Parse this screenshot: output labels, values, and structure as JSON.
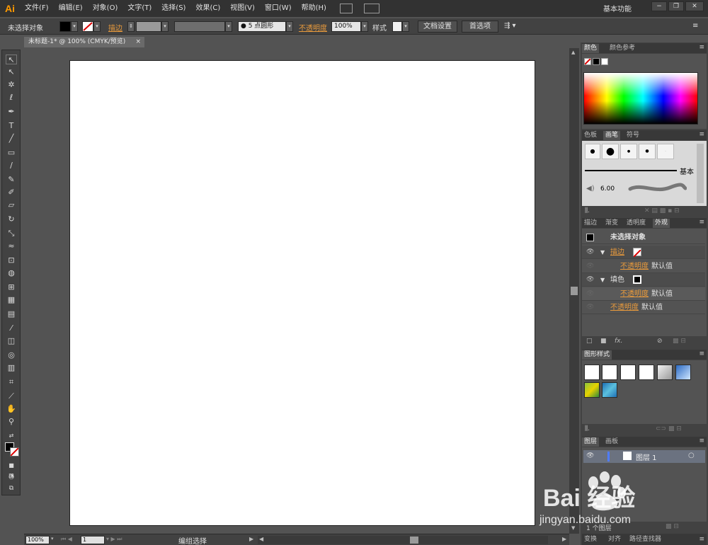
{
  "menubar": {
    "logo": "Ai",
    "items": [
      "文件(F)",
      "编辑(E)",
      "对象(O)",
      "文字(T)",
      "选择(S)",
      "效果(C)",
      "视图(V)",
      "窗口(W)",
      "帮助(H)"
    ],
    "workspace": "基本功能",
    "window_buttons": [
      "−",
      "❐",
      "✕"
    ]
  },
  "control": {
    "selection_label": "未选择对象",
    "stroke_label": "描边",
    "brush_value": "5 点圆形",
    "opacity_label": "不透明度",
    "opacity_value": "100%",
    "style_label": "样式",
    "doc_setup_button": "文档设置",
    "prefs_button": "首选项"
  },
  "document": {
    "tab_title": "未标题-1* @ 100% (CMYK/预览)",
    "tab_close": "×"
  },
  "status": {
    "zoom": "100%",
    "page": "1",
    "mode": "编组选择"
  },
  "panels": {
    "color": {
      "tabs": [
        "颜色",
        "颜色参考"
      ]
    },
    "brush": {
      "tabs": [
        "色板",
        "画笔",
        "符号"
      ],
      "basic_label": "基本",
      "size_value": "6.00"
    },
    "appearance": {
      "tabs": [
        "描边",
        "渐变",
        "透明度",
        "外观"
      ],
      "title": "未选择对象",
      "stroke_label": "描边",
      "opacity_label": "不透明度",
      "default_value": "默认值",
      "fill_label": "填色",
      "fx_label": "fx."
    },
    "graphic_styles": {
      "tabs": [
        "图形样式"
      ]
    },
    "layers": {
      "tabs": [
        "图层",
        "画板"
      ],
      "layer_name": "图层 1",
      "footer": "1 个图层"
    },
    "bottom": {
      "tabs": [
        "变换",
        "对齐",
        "路径查找器"
      ]
    }
  },
  "watermark": {
    "brand": "Bai 经验",
    "url": "jingyan.baidu.com"
  }
}
